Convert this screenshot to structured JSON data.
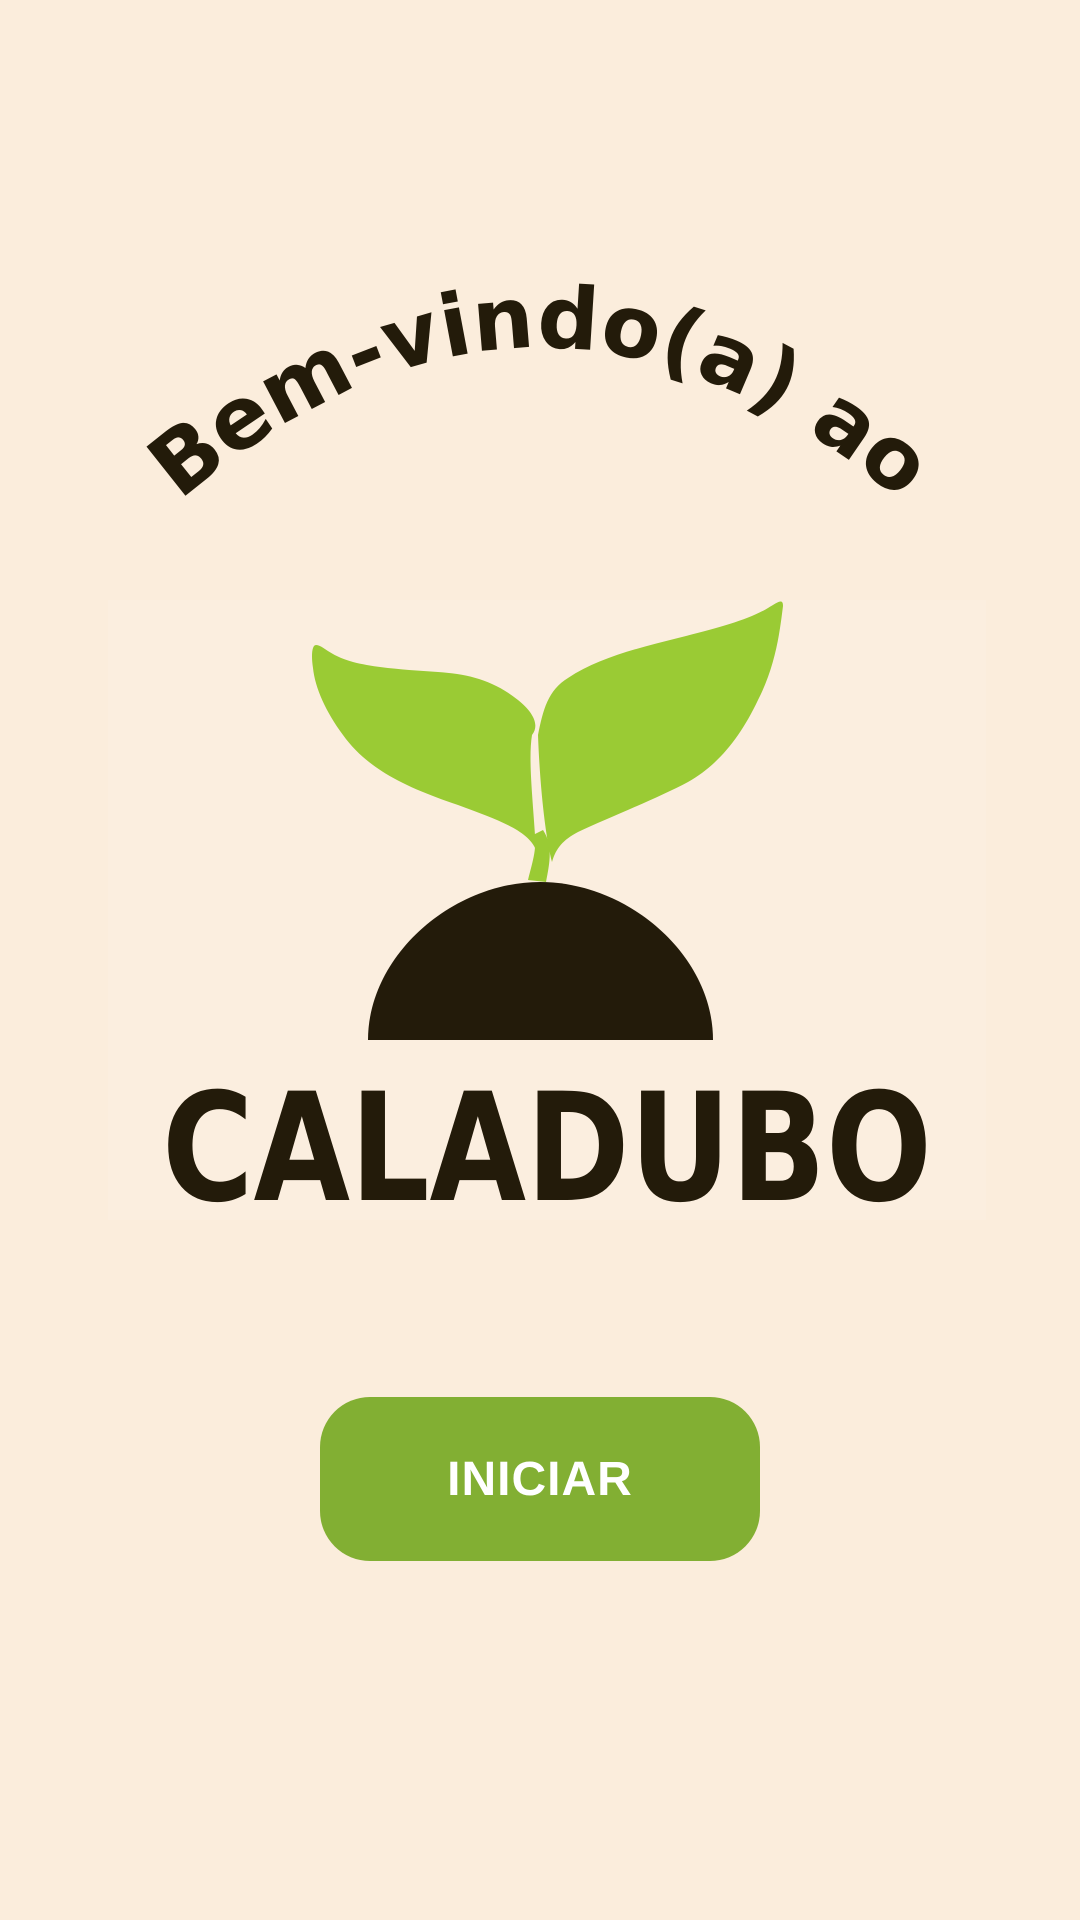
{
  "welcome": {
    "heading": "Bem-vindo(a) ao"
  },
  "logo": {
    "icon": "sprout-icon",
    "wordmark": "CALADUBO",
    "colors": {
      "leaf": "#9ACB34",
      "soil": "#231B0A"
    }
  },
  "actions": {
    "start_label": "INICIAR"
  },
  "theme": {
    "background": "#FBEDDC",
    "button": "#82AF33",
    "button_text": "#FFFFFF"
  }
}
